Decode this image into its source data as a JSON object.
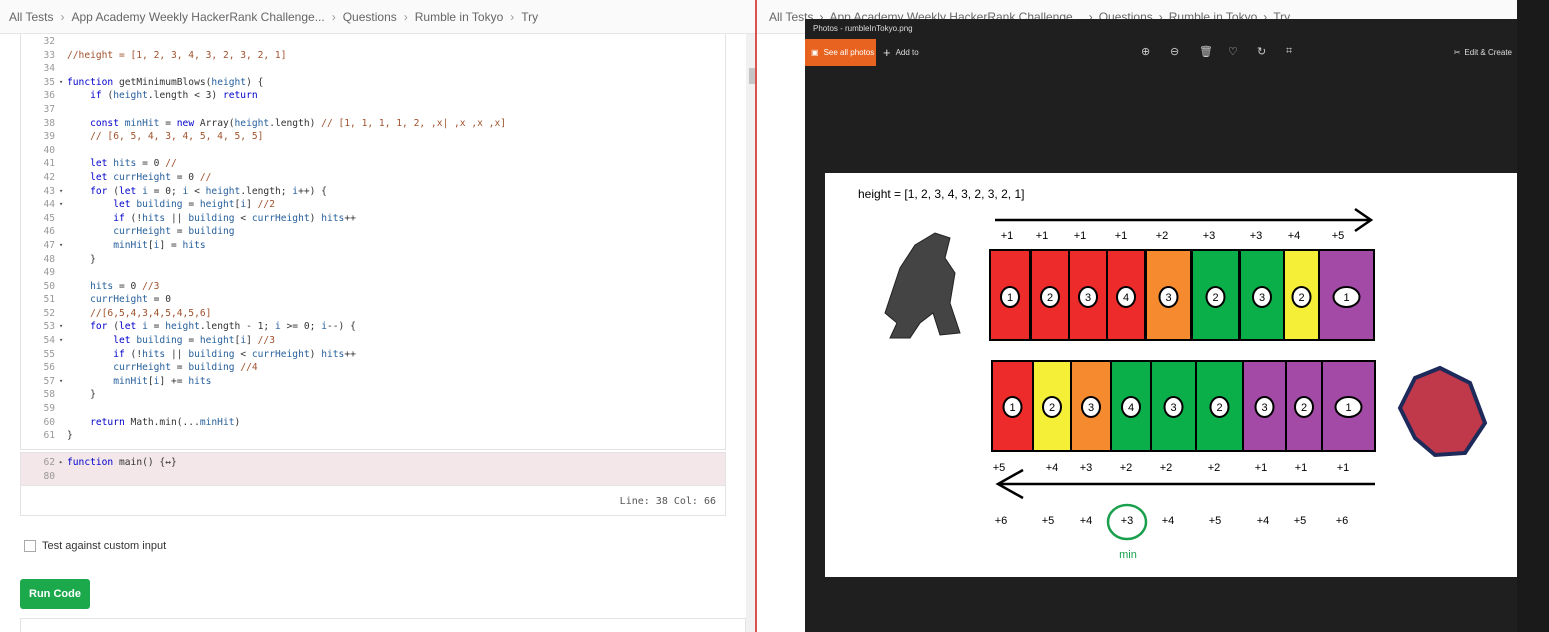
{
  "breadcrumb": {
    "items": [
      "All Tests",
      "App Academy Weekly HackerRank Challenge...",
      "Questions",
      "Rumble in Tokyo",
      "Try"
    ]
  },
  "code": [
    {
      "n": "32",
      "f": "",
      "t": ""
    },
    {
      "n": "33",
      "f": "",
      "t": "//height = [1, 2, 3, 4, 3, 2, 3, 2, 1]"
    },
    {
      "n": "34",
      "f": "",
      "t": ""
    },
    {
      "n": "35",
      "f": "▾",
      "t": "function getMinimumBlows(height) {"
    },
    {
      "n": "36",
      "f": "",
      "t": "    if (height.length < 3) return"
    },
    {
      "n": "37",
      "f": "",
      "t": ""
    },
    {
      "n": "38",
      "f": "",
      "t": "    const minHit = new Array(height.length) // [1, 1, 1, 1, 2, ,x| ,x ,x ,x]"
    },
    {
      "n": "39",
      "f": "",
      "t": "    // [6, 5, 4, 3, 4, 5, 4, 5, 5]"
    },
    {
      "n": "40",
      "f": "",
      "t": ""
    },
    {
      "n": "41",
      "f": "",
      "t": "    let hits = 0 //"
    },
    {
      "n": "42",
      "f": "",
      "t": "    let currHeight = 0 //"
    },
    {
      "n": "43",
      "f": "▾",
      "t": "    for (let i = 0; i < height.length; i++) {"
    },
    {
      "n": "44",
      "f": "▾",
      "t": "        let building = height[i] //2"
    },
    {
      "n": "45",
      "f": "",
      "t": "        if (!hits || building < currHeight) hits++"
    },
    {
      "n": "46",
      "f": "",
      "t": "        currHeight = building"
    },
    {
      "n": "47",
      "f": "▾",
      "t": "        minHit[i] = hits"
    },
    {
      "n": "48",
      "f": "",
      "t": "    }"
    },
    {
      "n": "49",
      "f": "",
      "t": ""
    },
    {
      "n": "50",
      "f": "",
      "t": "    hits = 0 //3"
    },
    {
      "n": "51",
      "f": "",
      "t": "    currHeight = 0"
    },
    {
      "n": "52",
      "f": "",
      "t": "    //[6,5,4,3,4,5,4,5,6]"
    },
    {
      "n": "53",
      "f": "▾",
      "t": "    for (let i = height.length - 1; i >= 0; i--) {"
    },
    {
      "n": "54",
      "f": "▾",
      "t": "        let building = height[i] //3"
    },
    {
      "n": "55",
      "f": "",
      "t": "        if (!hits || building < currHeight) hits++"
    },
    {
      "n": "56",
      "f": "",
      "t": "        currHeight = building //4"
    },
    {
      "n": "57",
      "f": "▾",
      "t": "        minHit[i] += hits"
    },
    {
      "n": "58",
      "f": "",
      "t": "    }"
    },
    {
      "n": "59",
      "f": "",
      "t": ""
    },
    {
      "n": "60",
      "f": "",
      "t": "    return Math.min(...minHit)"
    },
    {
      "n": "61",
      "f": "",
      "t": "}"
    }
  ],
  "collapsed": [
    {
      "n": "62",
      "f": "▸",
      "t": "function main() {↔}"
    },
    {
      "n": "80",
      "f": "",
      "t": ""
    }
  ],
  "status": {
    "position": "Line: 38 Col: 66"
  },
  "custom_input": {
    "label": "Test against custom input"
  },
  "run_button": {
    "label": "Run Code"
  },
  "photos": {
    "title": "Photos - rumbleInTokyo.png",
    "see_all": "See all photos",
    "add_to": "Add to",
    "edit_create": "Edit & Create",
    "heading": "height = [1, 2, 3, 4, 3, 2, 3, 2, 1]",
    "top_row": {
      "increments": [
        "+1",
        "+1",
        "+1",
        "+1",
        "+2",
        "+3",
        "+3",
        "+4",
        "+5"
      ],
      "labels": [
        "1",
        "2",
        "3",
        "4",
        "3",
        "2",
        "3",
        "2",
        "1"
      ],
      "colors": [
        "#ee2b2b",
        "#ee2b2b",
        "#ee2b2b",
        "#ee2b2b",
        "#f58a2e",
        "#0aaf4a",
        "#0aaf4a",
        "#f5ef37",
        "#a24aa6"
      ]
    },
    "bottom_row": {
      "increments": [
        "+5",
        "+4",
        "+3",
        "+2",
        "+2",
        "+2",
        "+1",
        "+1",
        "+1"
      ],
      "labels": [
        "1",
        "2",
        "3",
        "4",
        "3",
        "2",
        "3",
        "2",
        "1"
      ],
      "colors": [
        "#ee2b2b",
        "#f5ef37",
        "#f58a2e",
        "#0aaf4a",
        "#0aaf4a",
        "#0aaf4a",
        "#a24aa6",
        "#a24aa6",
        "#a24aa6"
      ]
    },
    "totals": [
      "+6",
      "+5",
      "+4",
      "+3",
      "+4",
      "+5",
      "+4",
      "+5",
      "+6"
    ],
    "min_label": "min"
  },
  "colors": {
    "run": "#1ba94c",
    "accent_orange": "#e8631f",
    "min_green": "#1aa04d"
  }
}
